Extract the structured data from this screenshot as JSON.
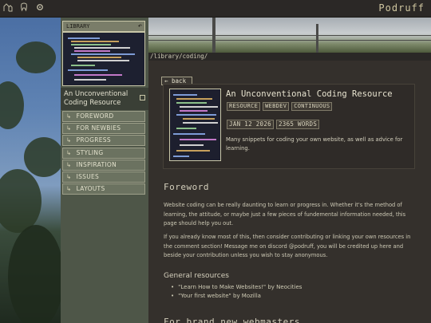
{
  "topbar": {
    "brand": "Podruff",
    "icons": [
      "library-icon",
      "tooth-icon",
      "gear-icon"
    ]
  },
  "sidebar": {
    "library_label": "LIBRARY",
    "back_glyph": "↶",
    "title": "An Unconventional Coding Resource",
    "items": [
      {
        "label": "FOREWORD"
      },
      {
        "label": "FOR NEWBIES"
      },
      {
        "label": "PROGRESS"
      },
      {
        "label": "STYLING"
      },
      {
        "label": "INSPIRATION"
      },
      {
        "label": "ISSUES"
      },
      {
        "label": "LAYOUTS"
      }
    ],
    "item_arrow": "↳"
  },
  "breadcrumb": "/library/coding/",
  "back_button": "← back",
  "card": {
    "title": "An Unconventional Coding Resource",
    "tags": [
      "RESOURCE",
      "WEBDEV",
      "CONTINUOUS"
    ],
    "date": "JAN 12 2026",
    "words": "2365 WORDS",
    "description": "Many snippets for coding your own website, as well as advice for learning."
  },
  "foreword": {
    "heading": "Foreword",
    "p1": "Website coding can be really daunting to learn or progress in. Whether it's the method of learning, the attitude, or maybe just a few pieces of fundemental information needed, this page should help you out.",
    "p2": "If you already know most of this, then consider contributing or linking your own resources in the comment section! Message me on discord @podruff, you will be credited up here and beside your contribution unless you wish to stay anonymous."
  },
  "general": {
    "heading": "General resources",
    "links": [
      "\"Learn How to Make Websites!\" by Neocities",
      "\"Your first website\" by Mozilla"
    ]
  },
  "next_heading": "For brand new webmasters",
  "colors": {
    "sidebar": "#4e5648",
    "nav_item": "#6b7260",
    "main_bg": "#34302c",
    "brand": "#cfc6a0"
  }
}
